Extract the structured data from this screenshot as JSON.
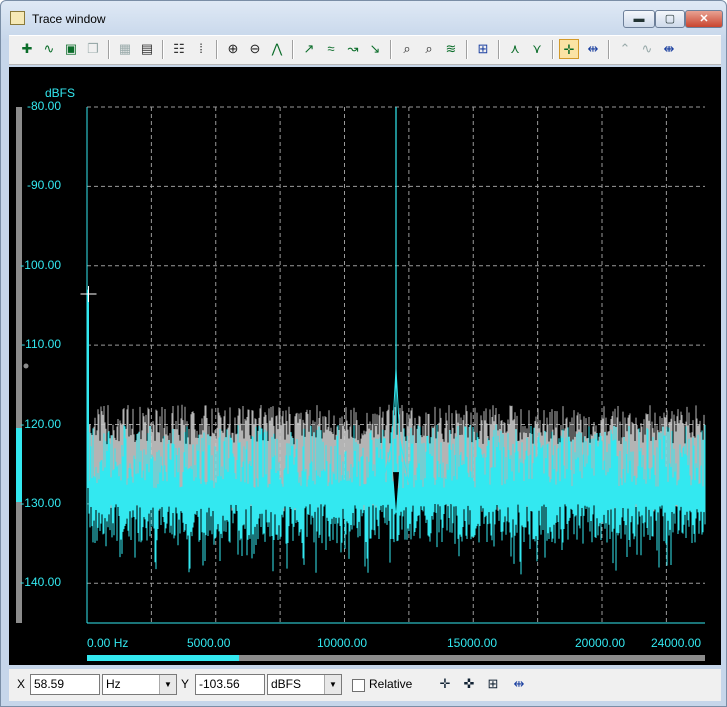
{
  "window": {
    "title": "Trace window",
    "controls": {
      "minimize": "▬",
      "maximize": "▢",
      "close": "✕"
    }
  },
  "toolbar": {
    "icons": [
      "trace-add-icon",
      "trace-wave-icon",
      "save-trace-icon",
      "copy-trace-icon",
      "grid-icon",
      "export-icon",
      "properties-icon",
      "table-icon",
      "zoom-in-icon",
      "zoom-out-icon",
      "autoscale-icon",
      "marker-left-icon",
      "marker-peak-icon",
      "marker-next-icon",
      "marker-prev-icon",
      "search-left-icon",
      "search-right-icon",
      "smooth-icon",
      "fit-icon",
      "peak-up-icon",
      "peak-down-icon",
      "marker-table-icon",
      "delta-marker-icon",
      "disabled-up-icon",
      "disabled-wave-icon",
      "disabled-pin-icon"
    ]
  },
  "chart_data": {
    "type": "line",
    "y_unit_label": "dBFS",
    "ylim": [
      -145,
      -80
    ],
    "y_ticks": [
      "-80.00",
      "-90.00",
      "-100.00",
      "-110.00",
      "-120.00",
      "-130.00",
      "-140.00"
    ],
    "xlim": [
      0,
      24000
    ],
    "x_ticks": [
      "0.00 Hz",
      "5000.00",
      "10000.00",
      "15000.00",
      "20000.00",
      "24000.00"
    ],
    "grid": true,
    "series": [
      {
        "color": "#33e8f0",
        "noise_floor": -128,
        "noise_top": -121,
        "dc_start": -103,
        "peak_frequency": 12000,
        "peak_level": -80
      }
    ],
    "cursor": {
      "x": 58.59,
      "y": -103.56
    },
    "colors": {
      "trace": "#33e8f0",
      "noise_overlay": "#c8c8c8",
      "grid": "#9a9a9a",
      "axis": "#33e8f0"
    }
  },
  "status": {
    "x_label": "X",
    "x_value": "58.59",
    "x_unit": "Hz",
    "y_label": "Y",
    "y_value": "-103.56",
    "y_unit": "dBFS",
    "relative_label": "Relative",
    "relative_checked": false
  }
}
